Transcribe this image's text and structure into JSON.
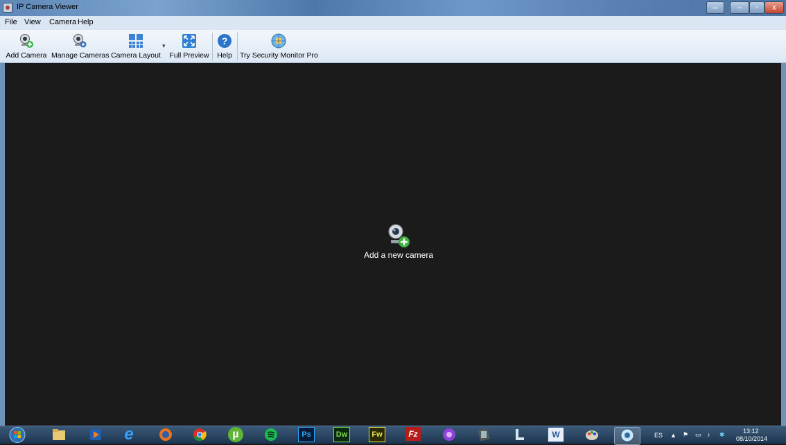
{
  "window": {
    "title": "IP Camera Viewer",
    "controls": {
      "restore_glyph": "⇔",
      "minimize_glyph": "–",
      "maximize_glyph": "▫",
      "close_glyph": "x"
    }
  },
  "menu": [
    "File",
    "View",
    "Camera",
    "Help"
  ],
  "toolbar": {
    "add_camera": "Add Camera",
    "manage_cameras": "Manage Cameras",
    "camera_layout": "Camera Layout",
    "layout_dropdown_glyph": "▾",
    "full_preview": "Full Preview",
    "help": "Help",
    "try_pro": "Try Security Monitor Pro"
  },
  "stage": {
    "empty_message": "Add a new camera"
  },
  "taskbar": {
    "apps": [
      {
        "name": "explorer",
        "label": ""
      },
      {
        "name": "media-player",
        "label": ""
      },
      {
        "name": "internet-explorer",
        "label": "e"
      },
      {
        "name": "firefox",
        "label": ""
      },
      {
        "name": "chrome",
        "label": ""
      },
      {
        "name": "utorrent",
        "label": "µ"
      },
      {
        "name": "spotify",
        "label": ""
      },
      {
        "name": "photoshop",
        "label": "Ps"
      },
      {
        "name": "dreamweaver",
        "label": "Dw"
      },
      {
        "name": "fireworks",
        "label": "Fw"
      },
      {
        "name": "filezilla",
        "label": "Fz"
      },
      {
        "name": "app-purple",
        "label": ""
      },
      {
        "name": "movie-maker",
        "label": ""
      },
      {
        "name": "app-l",
        "label": ""
      },
      {
        "name": "word",
        "label": "W"
      },
      {
        "name": "paint",
        "label": ""
      },
      {
        "name": "ip-camera-viewer",
        "label": ""
      }
    ],
    "tray": {
      "language": "ES",
      "time": "13:12",
      "date": "08/10/2014"
    }
  },
  "colors": {
    "accent": "#2f7fd6",
    "stage_bg": "#1b1b1b",
    "plus_green": "#3cb043"
  }
}
